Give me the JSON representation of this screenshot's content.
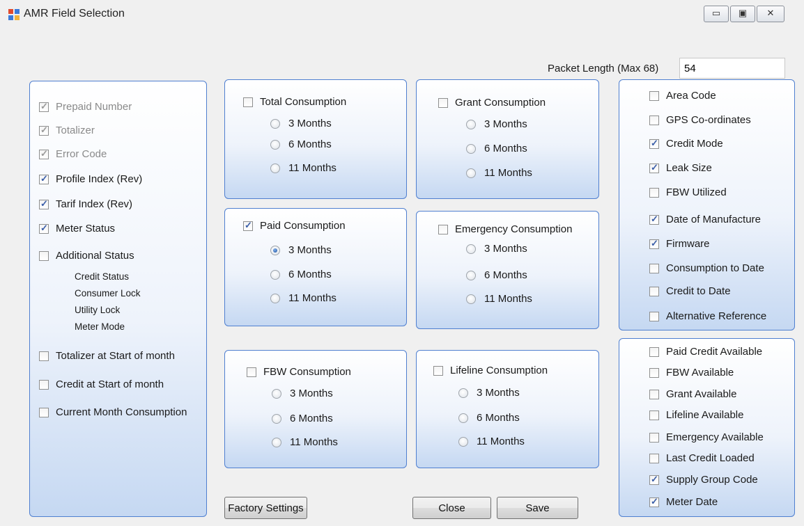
{
  "window": {
    "title": "AMR Field Selection",
    "icons": {
      "app": "app-window-icon",
      "minimize": "minimize-icon",
      "maximize": "maximize-icon",
      "close": "close-icon"
    }
  },
  "packet_length": {
    "label": "Packet Length (Max 68)",
    "value": "54"
  },
  "left_panel": {
    "items": [
      {
        "label": "Prepaid Number",
        "checked": true,
        "disabled": true
      },
      {
        "label": "Totalizer",
        "checked": true,
        "disabled": true
      },
      {
        "label": "Error Code",
        "checked": true,
        "disabled": true
      },
      {
        "label": "Profile Index (Rev)",
        "checked": true,
        "disabled": false
      },
      {
        "label": "Tarif Index (Rev)",
        "checked": true,
        "disabled": false
      },
      {
        "label": "Meter Status",
        "checked": true,
        "disabled": false
      },
      {
        "label": "Additional Status",
        "checked": false,
        "disabled": false
      },
      {
        "label": "Totalizer at Start of month",
        "checked": false,
        "disabled": false
      },
      {
        "label": "Credit at Start of month",
        "checked": false,
        "disabled": false
      },
      {
        "label": "Current Month Consumption",
        "checked": false,
        "disabled": false
      }
    ],
    "additional_status_subitems": [
      "Credit Status",
      "Consumer Lock",
      "Utility Lock",
      "Meter Mode"
    ]
  },
  "consumption_groups": [
    {
      "title": "Total Consumption",
      "checked": false,
      "options": [
        "3 Months",
        "6 Months",
        "11 Months"
      ],
      "selected": null
    },
    {
      "title": "Grant Consumption",
      "checked": false,
      "options": [
        "3 Months",
        "6 Months",
        "11 Months"
      ],
      "selected": null
    },
    {
      "title": "Paid Consumption",
      "checked": true,
      "options": [
        "3 Months",
        "6 Months",
        "11 Months"
      ],
      "selected": 0
    },
    {
      "title": "Emergency Consumption",
      "checked": false,
      "options": [
        "3 Months",
        "6 Months",
        "11 Months"
      ],
      "selected": null
    },
    {
      "title": "FBW Consumption",
      "checked": false,
      "options": [
        "3 Months",
        "6 Months",
        "11 Months"
      ],
      "selected": null
    },
    {
      "title": "Lifeline Consumption",
      "checked": false,
      "options": [
        "3 Months",
        "6 Months",
        "11 Months"
      ],
      "selected": null
    }
  ],
  "right_top_panel": {
    "items": [
      {
        "label": "Area Code",
        "checked": false
      },
      {
        "label": "GPS Co-ordinates",
        "checked": false
      },
      {
        "label": "Credit Mode",
        "checked": true
      },
      {
        "label": "Leak Size",
        "checked": true
      },
      {
        "label": "FBW Utilized",
        "checked": false
      },
      {
        "label": "Date of Manufacture",
        "checked": true
      },
      {
        "label": "Firmware",
        "checked": true
      },
      {
        "label": "Consumption to Date",
        "checked": false
      },
      {
        "label": "Credit to Date",
        "checked": false
      },
      {
        "label": "Alternative Reference",
        "checked": false
      }
    ]
  },
  "right_bottom_panel": {
    "items": [
      {
        "label": "Paid Credit Available",
        "checked": false
      },
      {
        "label": "FBW Available",
        "checked": false
      },
      {
        "label": "Grant Available",
        "checked": false
      },
      {
        "label": "Lifeline Available",
        "checked": false
      },
      {
        "label": "Emergency Available",
        "checked": false
      },
      {
        "label": "Last Credit Loaded",
        "checked": false
      },
      {
        "label": "Supply Group Code",
        "checked": true
      },
      {
        "label": "Meter Date",
        "checked": true
      }
    ]
  },
  "buttons": {
    "factory_settings": "Factory Settings",
    "close": "Close",
    "save": "Save"
  }
}
